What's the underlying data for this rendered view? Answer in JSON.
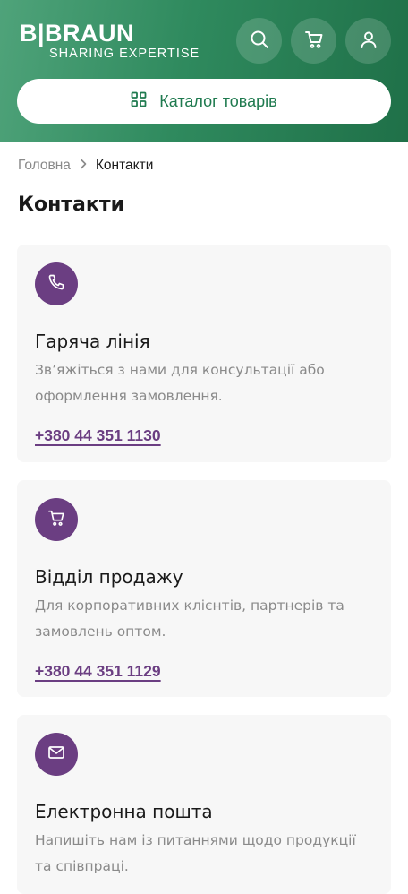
{
  "header": {
    "logo_main": "B|BRAUN",
    "logo_sub": "SHARING EXPERTISE",
    "actions": [
      {
        "icon": "search-icon"
      },
      {
        "icon": "cart-icon"
      },
      {
        "icon": "user-icon"
      }
    ],
    "catalog_label": "Каталог товарів"
  },
  "breadcrumb": {
    "home": "Головна",
    "current": "Контакти"
  },
  "page_title": "Контакти",
  "cards": [
    {
      "icon": "phone-icon",
      "title": "Гаряча лінія",
      "description": "Зв’яжіться з нами для консультації або оформлення замовлення.",
      "phone": "+380 44 351 1130"
    },
    {
      "icon": "cart-icon",
      "title": "Відділ продажу",
      "description": "Для корпоративних клієнтів, партнерів та замовлень оптом.",
      "phone": "+380 44 351 1129"
    },
    {
      "icon": "mail-icon",
      "title": "Електронна пошта",
      "description": "Напишіть нам із питаннями щодо продукції та співпраці."
    }
  ],
  "colors": {
    "brand_green": "#2f8a5e",
    "accent_purple": "#6b3e82",
    "card_bg": "#f7f7f7",
    "muted_text": "#8a8a8a"
  }
}
